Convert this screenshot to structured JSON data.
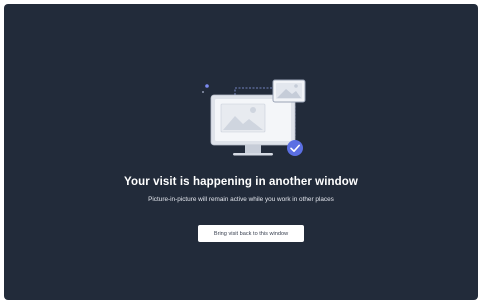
{
  "pip_notice": {
    "headline": "Your visit is happening in another window",
    "subtext": "Picture-in-picture will remain active while you work in other places",
    "button_label": "Bring visit back to this window"
  },
  "colors": {
    "panel_background": "#222b3a",
    "accent": "#5b6fe3"
  },
  "icons": [
    "monitor-icon",
    "pip-window-icon",
    "check-badge-icon"
  ]
}
